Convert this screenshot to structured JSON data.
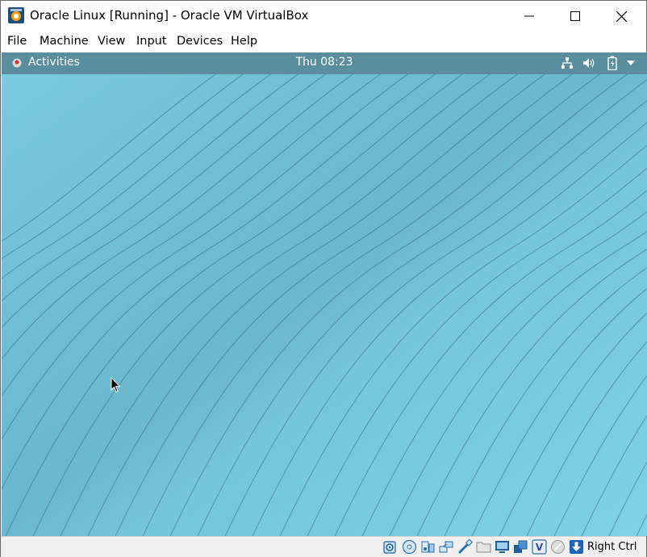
{
  "window": {
    "title": "Oracle Linux [Running] - Oracle VM VirtualBox",
    "controls": [
      "minimize-icon",
      "maximize-icon",
      "close-icon"
    ]
  },
  "menubar": {
    "items": [
      "File",
      "Machine",
      "View",
      "Input",
      "Devices",
      "Help"
    ]
  },
  "gnome": {
    "activities_label": "Activities",
    "clock": "Thu 08:23",
    "tray_icons": [
      "network-icon",
      "volume-icon",
      "battery-icon",
      "dropdown-arrow-icon"
    ]
  },
  "desktop": {
    "background_color": "#7ecfe4",
    "line_color": "#3d6a80"
  },
  "statusbar": {
    "icons": [
      "hard-disk-icon",
      "optical-drive-icon",
      "audio-icon",
      "network-adapter-icon",
      "usb-icon",
      "shared-folders-icon",
      "display-icon",
      "video-capture-icon",
      "virtualization-icon",
      "mouse-integration-icon",
      "host-key-arrow-icon"
    ],
    "host_key": "Right Ctrl"
  }
}
